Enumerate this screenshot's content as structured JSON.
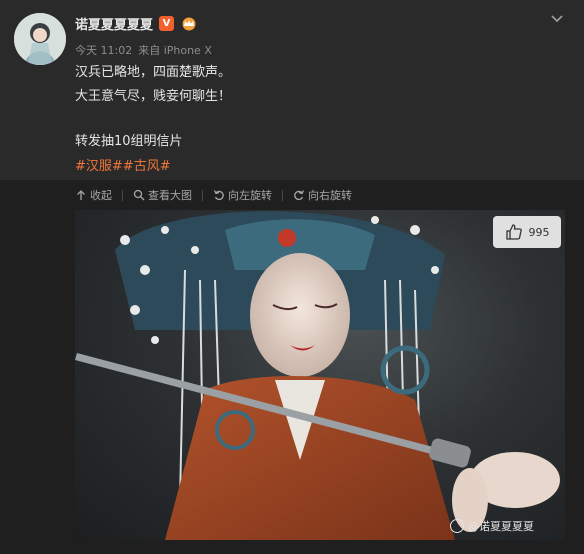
{
  "post": {
    "username": "诺夏夏夏夏夏",
    "vip_badge": "V",
    "meta_time": "今天 11:02",
    "meta_source": "来自 iPhone X",
    "lines": [
      "汉兵已略地，四面楚歌声。",
      "大王意气尽，贱妾何聊生！",
      "转发抽10组明信片"
    ],
    "tags": [
      "#汉服#",
      "#古风#"
    ]
  },
  "toolbar": {
    "collapse": "收起",
    "view_large": "查看大图",
    "rotate_left": "向左旋转",
    "rotate_right": "向右旋转"
  },
  "photo": {
    "likes": "995"
  },
  "watermark": {
    "text": "@诺夏夏夏夏"
  },
  "colors": {
    "tag": "#f0763a",
    "vip": "#f2612d",
    "background": "#1f1f20"
  }
}
